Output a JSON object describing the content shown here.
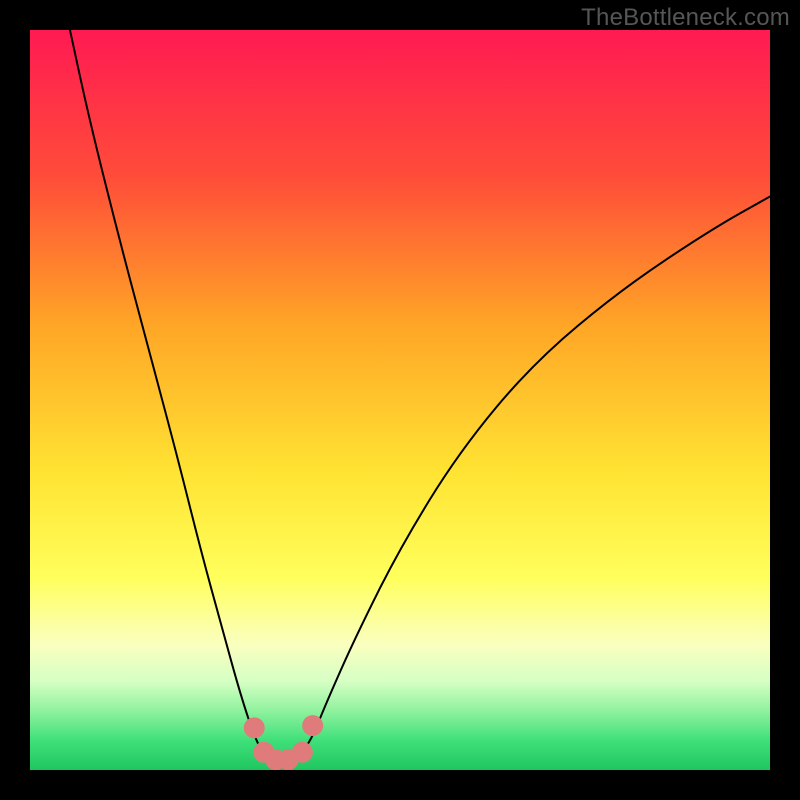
{
  "watermark": "TheBottleneck.com",
  "colors": {
    "background_black": "#000000",
    "curve": "#000000",
    "marker_fill": "#e07b7b",
    "marker_stroke": "#e07b7b",
    "green_band": "#2ecc71"
  },
  "chart_data": {
    "type": "line",
    "title": "",
    "xlabel": "",
    "ylabel": "",
    "xlim": [
      0,
      100
    ],
    "ylim": [
      0,
      100
    ],
    "grid": false,
    "legend": false,
    "background_gradient_stops": [
      {
        "offset": 0.0,
        "color": "#ff1a52"
      },
      {
        "offset": 0.2,
        "color": "#ff4d39"
      },
      {
        "offset": 0.4,
        "color": "#ffa626"
      },
      {
        "offset": 0.6,
        "color": "#ffe433"
      },
      {
        "offset": 0.74,
        "color": "#ffff5c"
      },
      {
        "offset": 0.83,
        "color": "#faffbf"
      },
      {
        "offset": 0.88,
        "color": "#d6ffc4"
      },
      {
        "offset": 0.92,
        "color": "#8ff29e"
      },
      {
        "offset": 0.96,
        "color": "#3fe07a"
      },
      {
        "offset": 1.0,
        "color": "#1fc65f"
      }
    ],
    "series": [
      {
        "name": "bottleneck-curve",
        "points": [
          {
            "x": 5.4,
            "y": 100.0
          },
          {
            "x": 8.0,
            "y": 88.0
          },
          {
            "x": 12.0,
            "y": 72.0
          },
          {
            "x": 16.0,
            "y": 57.0
          },
          {
            "x": 20.0,
            "y": 42.0
          },
          {
            "x": 23.0,
            "y": 30.0
          },
          {
            "x": 26.0,
            "y": 19.0
          },
          {
            "x": 28.5,
            "y": 10.0
          },
          {
            "x": 30.5,
            "y": 4.0
          },
          {
            "x": 32.0,
            "y": 1.5
          },
          {
            "x": 34.0,
            "y": 1.2
          },
          {
            "x": 36.0,
            "y": 1.5
          },
          {
            "x": 38.0,
            "y": 4.0
          },
          {
            "x": 40.0,
            "y": 9.0
          },
          {
            "x": 44.0,
            "y": 18.0
          },
          {
            "x": 50.0,
            "y": 30.0
          },
          {
            "x": 58.0,
            "y": 43.0
          },
          {
            "x": 68.0,
            "y": 55.0
          },
          {
            "x": 80.0,
            "y": 65.0
          },
          {
            "x": 92.0,
            "y": 73.0
          },
          {
            "x": 100.0,
            "y": 77.5
          }
        ]
      }
    ],
    "markers": [
      {
        "x": 30.3,
        "y": 5.7
      },
      {
        "x": 31.6,
        "y": 2.4
      },
      {
        "x": 33.2,
        "y": 1.4
      },
      {
        "x": 34.9,
        "y": 1.4
      },
      {
        "x": 36.8,
        "y": 2.4
      },
      {
        "x": 38.2,
        "y": 6.0
      }
    ]
  }
}
